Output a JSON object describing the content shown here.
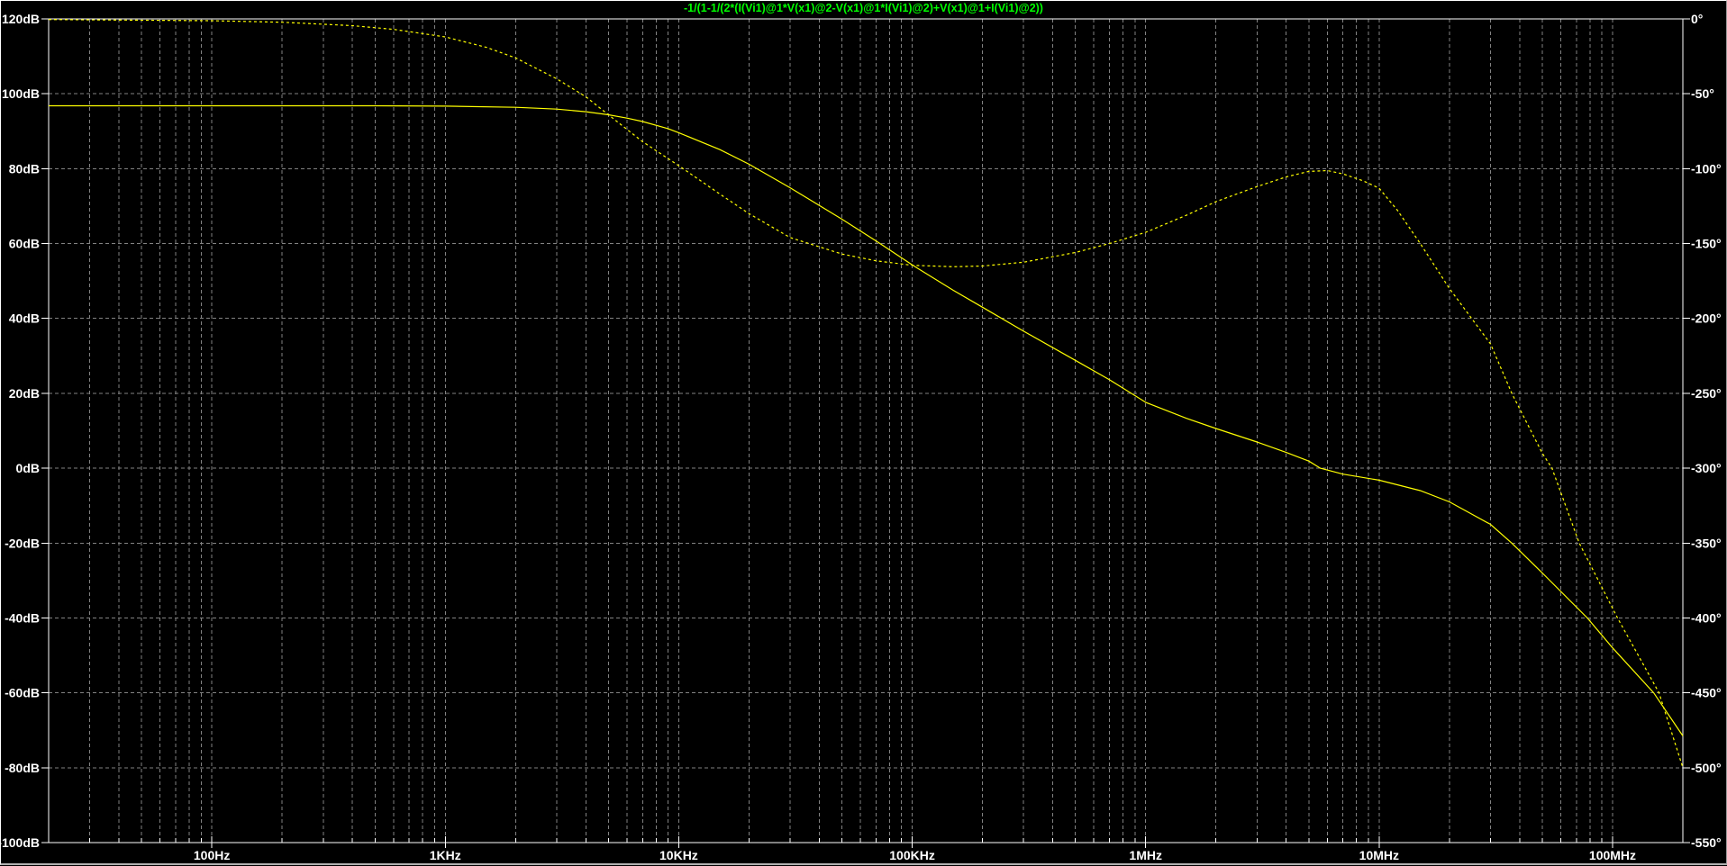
{
  "window": {
    "app": "waveform-viewer"
  },
  "chart_data": {
    "type": "line",
    "title": "-1/(1-1/(2*(I(Vi1)@1*V(x1)@2-V(x1)@1*I(Vi1)@2)+V(x1)@1+I(Vi1)@2))",
    "title_color": "#00ff00",
    "background": "#000000",
    "grid": {
      "color": "#828282",
      "dashed": true,
      "minor_vertical_log_grid": true,
      "legend": "none"
    },
    "x_axis": {
      "scale": "log",
      "unit": "Hz",
      "min": 20,
      "max": 200000000,
      "labels": [
        {
          "value": 100,
          "label": "100Hz"
        },
        {
          "value": 1000,
          "label": "1KHz"
        },
        {
          "value": 10000,
          "label": "10KHz"
        },
        {
          "value": 100000,
          "label": "100KHz"
        },
        {
          "value": 1000000,
          "label": "1MHz"
        },
        {
          "value": 10000000,
          "label": "10MHz"
        },
        {
          "value": 100000000,
          "label": "100MHz"
        }
      ]
    },
    "y_left": {
      "unit": "dB",
      "min": -100,
      "max": 120,
      "step": 20,
      "labels": [
        {
          "value": 120,
          "label": "120dB"
        },
        {
          "value": 100,
          "label": "100dB"
        },
        {
          "value": 80,
          "label": "80dB"
        },
        {
          "value": 60,
          "label": "60dB"
        },
        {
          "value": 40,
          "label": "40dB"
        },
        {
          "value": 20,
          "label": "20dB"
        },
        {
          "value": 0,
          "label": "0dB"
        },
        {
          "value": -20,
          "label": "-20dB"
        },
        {
          "value": -40,
          "label": "-40dB"
        },
        {
          "value": -60,
          "label": "-60dB"
        },
        {
          "value": -80,
          "label": "-80dB"
        },
        {
          "value": -100,
          "label": "-100dB"
        }
      ]
    },
    "y_right": {
      "unit": "°",
      "min": -550,
      "max": 0,
      "step": 50,
      "labels": [
        {
          "value": 0,
          "label": "0°"
        },
        {
          "value": -50,
          "label": "-50°"
        },
        {
          "value": -100,
          "label": "-100°"
        },
        {
          "value": -150,
          "label": "-150°"
        },
        {
          "value": -200,
          "label": "-200°"
        },
        {
          "value": -250,
          "label": "-250°"
        },
        {
          "value": -300,
          "label": "-300°"
        },
        {
          "value": -350,
          "label": "-350°"
        },
        {
          "value": -400,
          "label": "-400°"
        },
        {
          "value": -450,
          "label": "-450°"
        },
        {
          "value": -500,
          "label": "-500°"
        },
        {
          "value": -550,
          "label": "-550°"
        }
      ]
    },
    "series": [
      {
        "name": "magnitude",
        "axis": "left",
        "color": "#ffff00",
        "style": "solid",
        "points": [
          [
            20,
            96.8
          ],
          [
            100,
            96.8
          ],
          [
            500,
            96.8
          ],
          [
            1000,
            96.7
          ],
          [
            2000,
            96.4
          ],
          [
            3000,
            95.9
          ],
          [
            4000,
            95.2
          ],
          [
            5000,
            94.4
          ],
          [
            6000,
            93.5
          ],
          [
            7000,
            92.6
          ],
          [
            9000,
            90.7
          ],
          [
            10000,
            89.6
          ],
          [
            15000,
            85.1
          ],
          [
            20000,
            81.2
          ],
          [
            30000,
            74.9
          ],
          [
            50000,
            66.5
          ],
          [
            70000,
            60.7
          ],
          [
            100000,
            54.3
          ],
          [
            150000,
            47.5
          ],
          [
            200000,
            43.0
          ],
          [
            300000,
            36.6
          ],
          [
            500000,
            28.8
          ],
          [
            700000,
            23.6
          ],
          [
            1000000,
            17.6
          ],
          [
            1500000,
            13.3
          ],
          [
            2000000,
            10.6
          ],
          [
            3000000,
            7.0
          ],
          [
            4000000,
            4.2
          ],
          [
            5000000,
            1.9
          ],
          [
            5600000,
            0.0
          ],
          [
            7000000,
            -1.6
          ],
          [
            10000000,
            -3.2
          ],
          [
            15000000,
            -6.0
          ],
          [
            20000000,
            -9.0
          ],
          [
            30000000,
            -15.0
          ],
          [
            37000000,
            -20.0
          ],
          [
            50000000,
            -28.0
          ],
          [
            78000000,
            -40.0
          ],
          [
            100000000,
            -48.0
          ],
          [
            150000000,
            -60.0
          ],
          [
            200000000,
            -71.5
          ]
        ]
      },
      {
        "name": "phase",
        "axis": "right",
        "color": "#ffff00",
        "style": "dotted",
        "points": [
          [
            20,
            -0.4
          ],
          [
            100,
            -1.2
          ],
          [
            200,
            -2.2
          ],
          [
            400,
            -4.5
          ],
          [
            600,
            -7
          ],
          [
            1000,
            -12
          ],
          [
            1500,
            -19
          ],
          [
            2000,
            -26
          ],
          [
            3000,
            -40
          ],
          [
            4000,
            -52
          ],
          [
            5000,
            -64
          ],
          [
            7000,
            -82
          ],
          [
            10000,
            -98
          ],
          [
            15000,
            -117
          ],
          [
            20000,
            -130
          ],
          [
            30000,
            -146
          ],
          [
            50000,
            -157
          ],
          [
            70000,
            -161.5
          ],
          [
            100000,
            -164.5
          ],
          [
            150000,
            -165.5
          ],
          [
            200000,
            -165
          ],
          [
            300000,
            -162.5
          ],
          [
            500000,
            -156
          ],
          [
            700000,
            -150
          ],
          [
            1000000,
            -142.5
          ],
          [
            1500000,
            -131
          ],
          [
            2000000,
            -122
          ],
          [
            3000000,
            -112
          ],
          [
            4000000,
            -105.5
          ],
          [
            5000000,
            -101.8
          ],
          [
            6000000,
            -101.3
          ],
          [
            7000000,
            -103.5
          ],
          [
            8500000,
            -108
          ],
          [
            10000000,
            -113
          ],
          [
            12000000,
            -128
          ],
          [
            15000000,
            -150
          ],
          [
            20000000,
            -180
          ],
          [
            30000000,
            -217
          ],
          [
            37000000,
            -250
          ],
          [
            50000000,
            -290
          ],
          [
            55000000,
            -300
          ],
          [
            72000000,
            -350
          ],
          [
            105000000,
            -400
          ],
          [
            158000000,
            -450
          ],
          [
            200000000,
            -500
          ]
        ]
      }
    ]
  }
}
